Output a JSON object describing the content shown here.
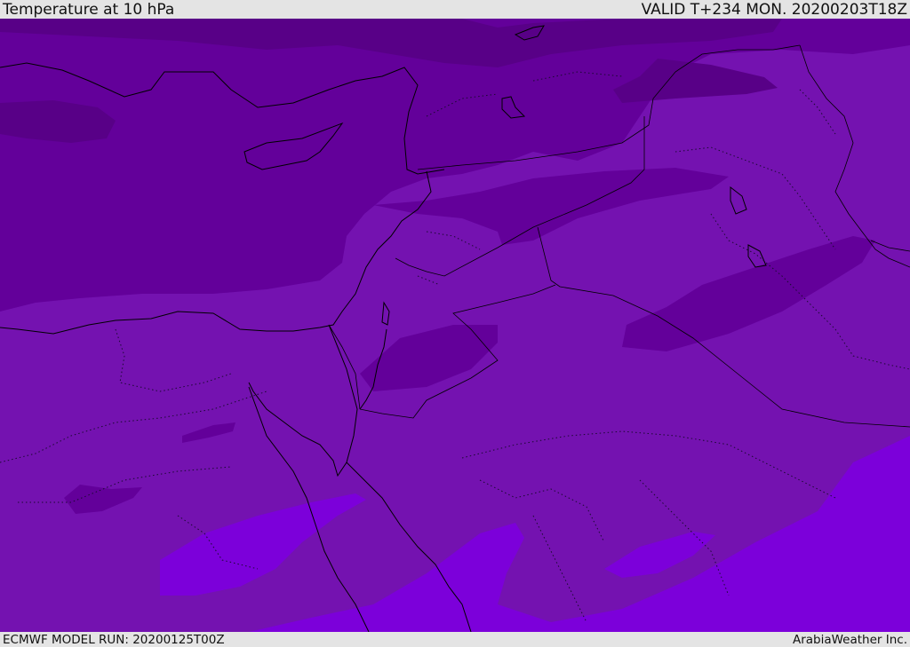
{
  "header": {
    "title": "Temperature at 10 hPa",
    "valid": "VALID T+234 MON. 20200203T18Z"
  },
  "footer": {
    "model_run": "ECMWF MODEL RUN: 20200125T00Z",
    "credit": "ArabiaWeather Inc."
  },
  "map": {
    "band_colors": {
      "coldest": "#580087",
      "cold": "#63009a",
      "mid": "#7412b0",
      "warm": "#7c00da"
    },
    "line_color": "#000000"
  }
}
